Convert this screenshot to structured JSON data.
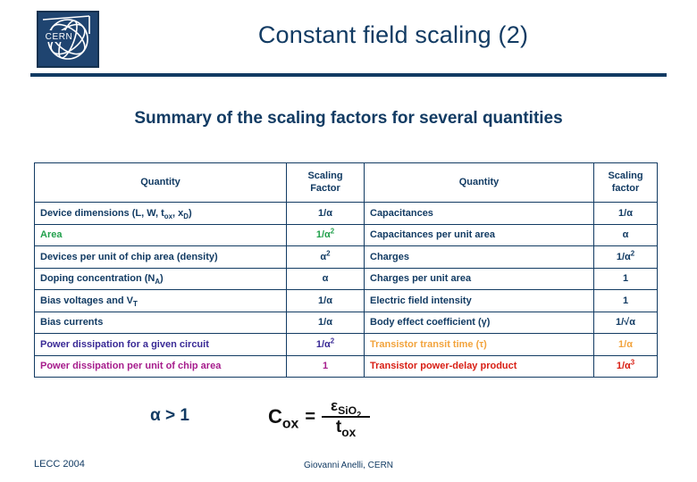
{
  "slide": {
    "title": "Constant field scaling (2)",
    "subtitle": "Summary of the scaling factors for several quantities",
    "logo_text": "CERN",
    "accent_color": "#123B63"
  },
  "table": {
    "headers": {
      "col1": "Quantity",
      "col2_line1": "Scaling",
      "col2_line2": "Factor",
      "col3": "Quantity",
      "col4_line1": "Scaling",
      "col4_line2": "factor"
    },
    "rows": [
      {
        "left_quantity": "Device dimensions (L, W, tox, xD)",
        "left_factor": "1/α",
        "left_color": "#123B63",
        "right_quantity": "Capacitances",
        "right_factor": "1/α",
        "right_color": "#123B63"
      },
      {
        "left_quantity": "Area",
        "left_factor": "1/α²",
        "left_color": "#22A04C",
        "right_quantity": "Capacitances per unit area",
        "right_factor": "α",
        "right_color": "#123B63"
      },
      {
        "left_quantity": "Devices per unit of chip area (density)",
        "left_factor": "α²",
        "left_color": "#123B63",
        "right_quantity": "Charges",
        "right_factor": "1/α²",
        "right_color": "#123B63"
      },
      {
        "left_quantity": "Doping concentration (NA)",
        "left_factor": "α",
        "left_color": "#123B63",
        "right_quantity": "Charges per unit area",
        "right_factor": "1",
        "right_color": "#123B63"
      },
      {
        "left_quantity": "Bias voltages and VT",
        "left_factor": "1/α",
        "left_color": "#123B63",
        "right_quantity": "Electric field intensity",
        "right_factor": "1",
        "right_color": "#123B63"
      },
      {
        "left_quantity": "Bias currents",
        "left_factor": "1/α",
        "left_color": "#123B63",
        "right_quantity": "Body effect coefficient (γ)",
        "right_factor": "1/√α",
        "right_color": "#123B63"
      },
      {
        "left_quantity": "Power dissipation for a given circuit",
        "left_factor": "1/α²",
        "left_color": "#3A2A96",
        "right_quantity": "Transistor transit time (τ)",
        "right_factor": "1/α",
        "right_color": "#F2A33C"
      },
      {
        "left_quantity": "Power dissipation per unit of chip area",
        "left_factor": "1",
        "left_color": "#A61C8C",
        "right_quantity": "Transistor power-delay product",
        "right_factor": "1/α³",
        "right_color": "#D81E14"
      }
    ]
  },
  "formulas": {
    "alpha_note": "α > 1",
    "cox_lhs": "Cox",
    "cox_equals": "=",
    "cox_numerator": "εSiO2",
    "cox_denominator": "tox"
  },
  "footer": {
    "left": "LECC 2004",
    "center": "Giovanni Anelli, CERN"
  }
}
